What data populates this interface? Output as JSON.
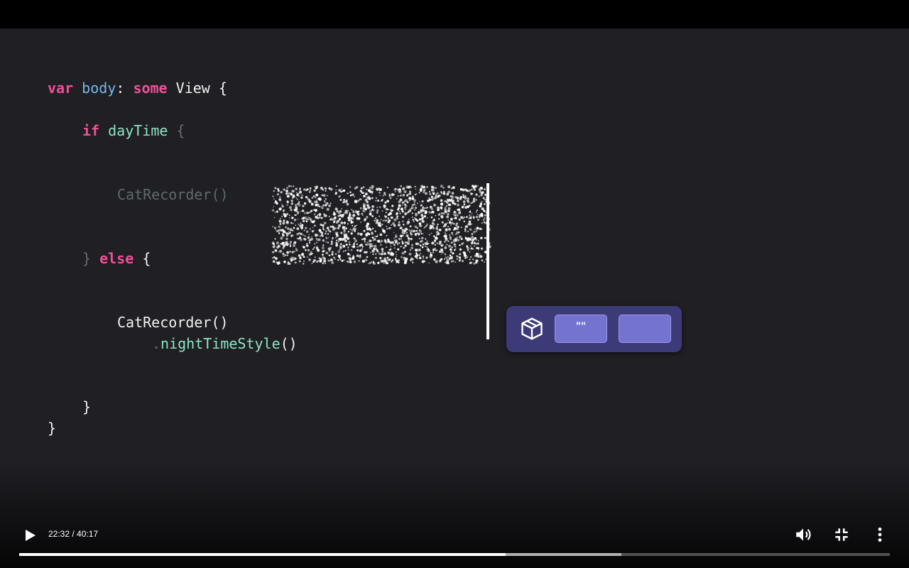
{
  "code": {
    "line1": {
      "kw": "var",
      "name": "body",
      "colon": ":",
      "kw2": "some",
      "type": "View",
      "brace": "{"
    },
    "line2": {
      "kw": "if",
      "cond": "dayTime",
      "brace": "{"
    },
    "line3": {
      "call": "CatRecorder()"
    },
    "line4": {
      "close": "}",
      "kw": "else",
      "brace": "{"
    },
    "line5": {
      "call": "CatRecorder()"
    },
    "line6": {
      "dot": ".",
      "method": "nightTimeStyle",
      "parens": "()"
    },
    "line7": {
      "close": "}"
    },
    "line8": {
      "close": "}"
    }
  },
  "popup": {
    "icon": "package-icon",
    "btn1_label": "\"\"",
    "btn2_label": ""
  },
  "player": {
    "time": "22:32 / 40:17",
    "progress_played": 0.559,
    "progress_buffered": 0.692,
    "icons": {
      "play": "play-icon",
      "volume": "volume-icon",
      "exit_fullscreen": "exit-fullscreen-icon",
      "more": "more-vert-icon"
    }
  },
  "colors": {
    "keyword": "#f0509a",
    "identifier_blue": "#74b7ec",
    "identifier_green": "#8fe3c4",
    "popup_bg": "#3d3a78",
    "popup_button": "#7474d0"
  }
}
